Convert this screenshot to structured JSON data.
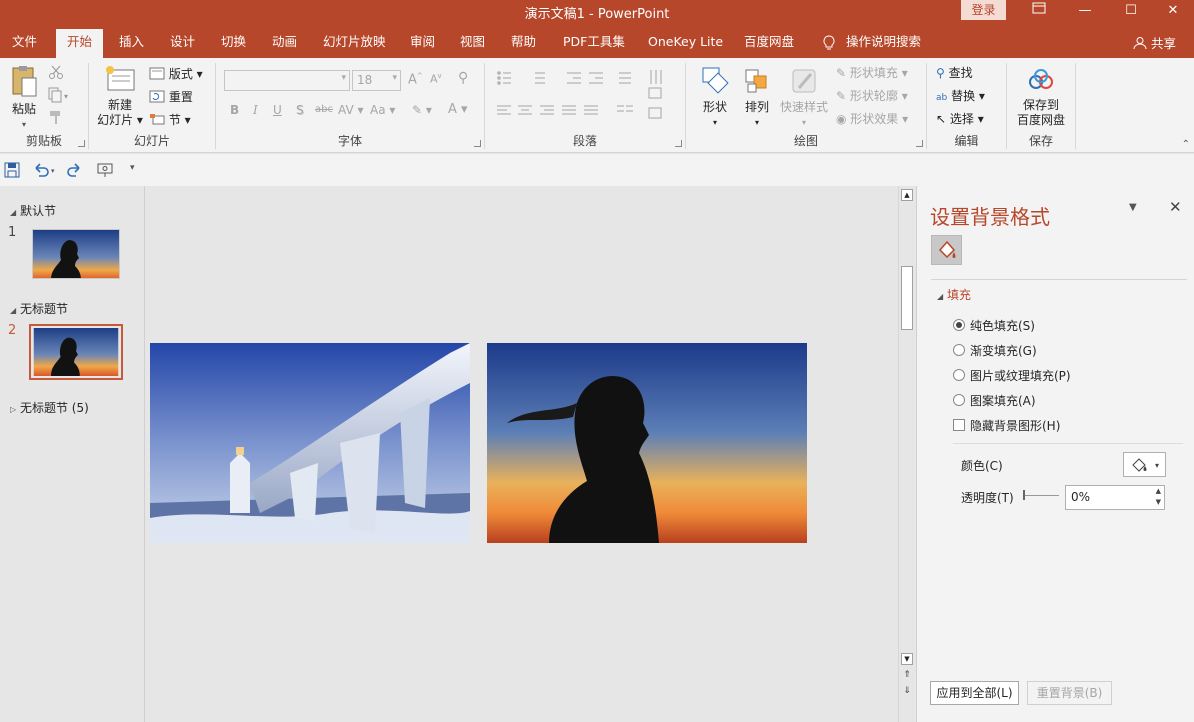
{
  "window": {
    "title": "演示文稿1  -  PowerPoint",
    "login": "登录"
  },
  "menu": {
    "tabs": [
      "文件",
      "开始",
      "插入",
      "设计",
      "切换",
      "动画",
      "幻灯片放映",
      "审阅",
      "视图",
      "帮助",
      "PDF工具集",
      "OneKey Lite",
      "百度网盘",
      "操作说明搜索"
    ],
    "active": "开始",
    "share": "共享"
  },
  "ribbon": {
    "clipboard": {
      "paste": "粘贴",
      "label": "剪贴板"
    },
    "slides": {
      "new_slide_1": "新建",
      "new_slide_2": "幻灯片",
      "layout": "版式",
      "reset": "重置",
      "section": "节",
      "label": "幻灯片"
    },
    "font": {
      "size": "18",
      "label": "字体",
      "buttons": [
        "B",
        "I",
        "U",
        "S",
        "abc",
        "AV",
        "Aa",
        "A"
      ]
    },
    "paragraph": {
      "label": "段落"
    },
    "drawing": {
      "shape": "形状",
      "arrange": "排列",
      "quick_styles": "快速样式",
      "shape_fill": "形状填充",
      "shape_outline": "形状轮廓",
      "shape_effects": "形状效果",
      "label": "绘图"
    },
    "editing": {
      "find": "查找",
      "replace": "替换",
      "select": "选择",
      "label": "编辑"
    },
    "save": {
      "save_1": "保存到",
      "save_2": "百度网盘",
      "label": "保存"
    }
  },
  "thumbnails": {
    "section1": "默认节",
    "section2": "无标题节",
    "section3": "无标题节 (5)",
    "slides": [
      {
        "number": "1"
      },
      {
        "number": "2"
      }
    ]
  },
  "format_pane": {
    "title": "设置背景格式",
    "fill_header": "填充",
    "options": [
      {
        "label": "纯色填充(S)",
        "selected": true
      },
      {
        "label": "渐变填充(G)",
        "selected": false
      },
      {
        "label": "图片或纹理填充(P)",
        "selected": false
      },
      {
        "label": "图案填充(A)",
        "selected": false
      }
    ],
    "hide_bg": "隐藏背景图形(H)",
    "color_label": "颜色(C)",
    "transparency_label": "透明度(T)",
    "transparency_value": "0%",
    "apply_all": "应用到全部(L)",
    "reset_bg": "重置背景(B)"
  },
  "colors": {
    "accent": "#b7472a",
    "ribbon": "#f3f3f3",
    "canvas": "#e6e6e6"
  }
}
